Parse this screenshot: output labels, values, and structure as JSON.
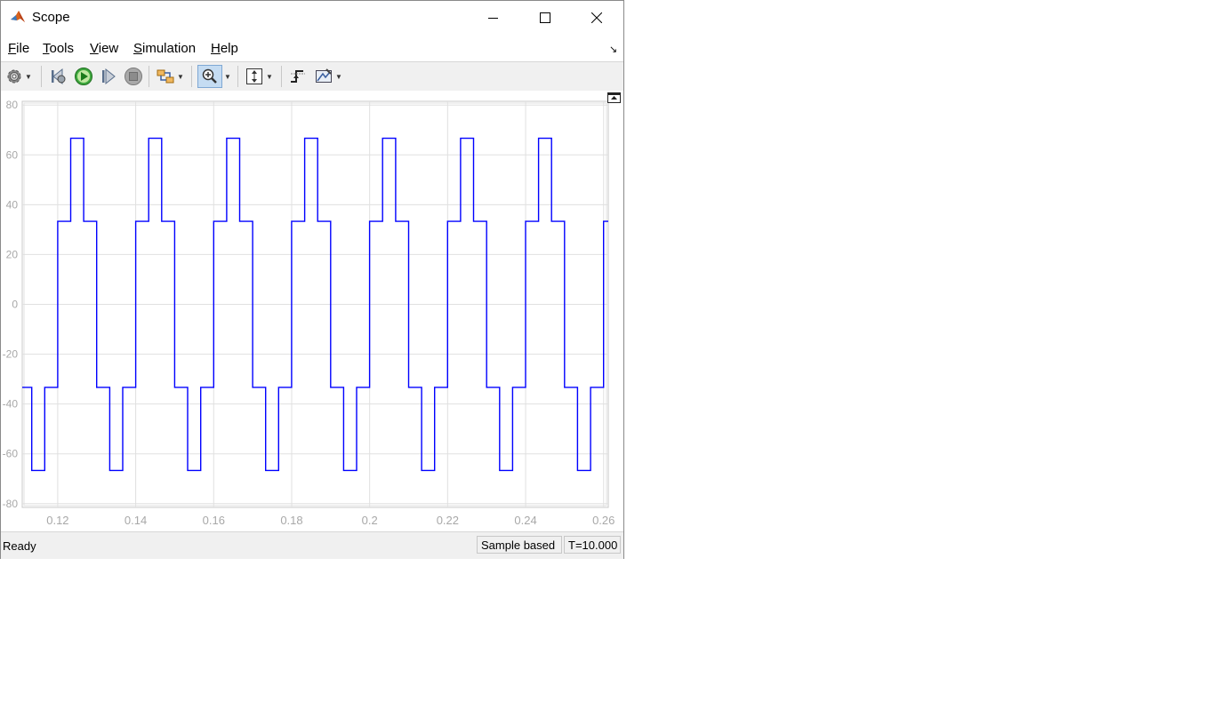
{
  "window": {
    "title": "Scope",
    "app_icon": "matlab-icon"
  },
  "menu": [
    {
      "label": "File",
      "mnemonic": "F",
      "rest": "ile"
    },
    {
      "label": "Tools",
      "mnemonic": "T",
      "rest": "ools"
    },
    {
      "label": "View",
      "mnemonic": "V",
      "rest": "iew"
    },
    {
      "label": "Simulation",
      "mnemonic": "S",
      "rest": "imulation"
    },
    {
      "label": "Help",
      "mnemonic": "H",
      "rest": "elp"
    }
  ],
  "toolbar": {
    "icons": [
      "settings-icon",
      "step-back-icon",
      "run-icon",
      "step-forward-icon",
      "stop-icon",
      "signal-highlight-icon",
      "zoom-in-icon",
      "autoscale-icon",
      "triggers-icon",
      "measurements-icon"
    ],
    "zoom_active": true
  },
  "status": {
    "left": "Ready",
    "mode": "Sample based",
    "time": "T=10.000"
  },
  "chart_data": {
    "type": "line",
    "xlim": [
      0.1109,
      0.2612
    ],
    "ylim": [
      -81.5,
      81.5
    ],
    "xticks": [
      0.12,
      0.14,
      0.16,
      0.18,
      0.2,
      0.22,
      0.24,
      0.26
    ],
    "xtick_labels": [
      "0.12",
      "0.14",
      "0.16",
      "0.18",
      "0.2",
      "0.22",
      "0.24",
      "0.26"
    ],
    "yticks": [
      -80,
      -60,
      -40,
      -20,
      0,
      20,
      40,
      60,
      80
    ],
    "ytick_labels": [
      "-80",
      "-60",
      "-40",
      "-20",
      "0",
      "20",
      "40",
      "60",
      "80"
    ],
    "grid": true,
    "line_color": "#0000ff",
    "waveform": {
      "shape": "six-step stepped wave",
      "period": 0.02,
      "phase_start": 0.12,
      "levels": [
        33.33,
        66.67,
        33.33,
        -33.33,
        -66.67,
        -33.33
      ],
      "step_duration": 0.003333
    },
    "start_value": -33.33,
    "end_x": 0.2612
  }
}
